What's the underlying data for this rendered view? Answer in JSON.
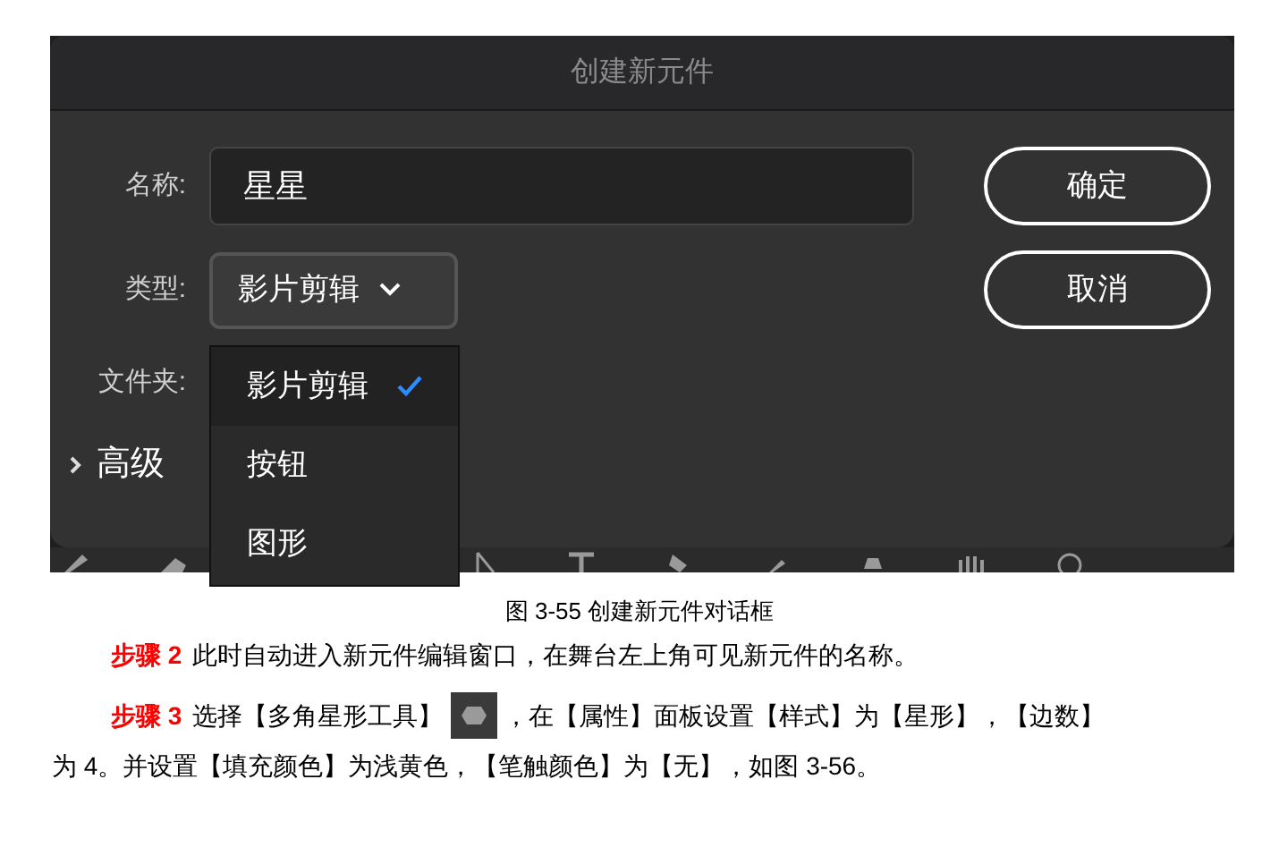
{
  "dialog": {
    "title": "创建新元件",
    "name_field": {
      "label": "名称:",
      "value": "星星"
    },
    "type_field": {
      "label": "类型:",
      "value": "影片剪辑",
      "options": [
        {
          "label": "影片剪辑",
          "selected": true
        },
        {
          "label": "按钮",
          "selected": false
        },
        {
          "label": "图形",
          "selected": false
        }
      ]
    },
    "folder_label": "文件夹:",
    "advanced": {
      "label": "高级",
      "expanded": false
    },
    "buttons": [
      "确定",
      "取消"
    ]
  },
  "caption": "图 3-55 创建新元件对话框",
  "steps": [
    {
      "label": "步骤 2",
      "text": "此时自动进入新元件编辑窗口，在舞台左上角可见新元件的名称。"
    },
    {
      "label": "步骤 3",
      "text": "选择【多角星形工具】",
      "text_after_icon": "，在【属性】面板设置【样式】为【星形】，【边数】",
      "continuation": "为 4。并设置【填充颜色】为浅黄色，【笔触颜色】为【无】，如图 3-56。"
    }
  ]
}
